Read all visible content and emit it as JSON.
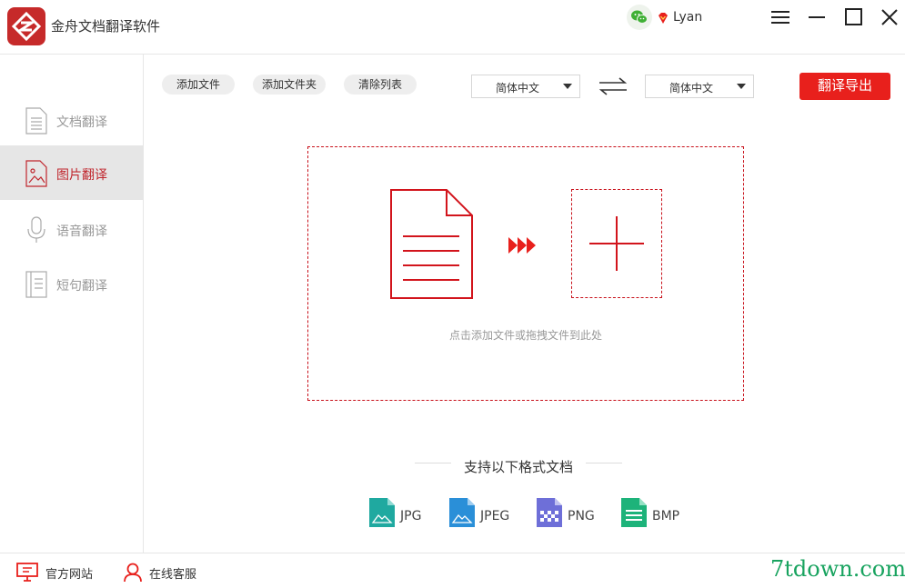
{
  "app": {
    "title": "金舟文档翻译软件"
  },
  "user": {
    "name": "Lyan"
  },
  "sidebar": {
    "items": [
      {
        "label": "文档翻译",
        "icon": "document-icon",
        "active": false
      },
      {
        "label": "图片翻译",
        "icon": "image-icon",
        "active": true
      },
      {
        "label": "语音翻译",
        "icon": "microphone-icon",
        "active": false
      },
      {
        "label": "短句翻译",
        "icon": "note-icon",
        "active": false
      }
    ]
  },
  "toolbar": {
    "add_file": "添加文件",
    "add_folder": "添加文件夹",
    "clear_list": "清除列表",
    "source_lang": "简体中文",
    "target_lang": "简体中文",
    "translate_export": "翻译导出"
  },
  "drop_zone": {
    "hint": "点击添加文件或拖拽文件到此处"
  },
  "formats": {
    "title": "支持以下格式文档",
    "items": [
      {
        "label": "JPG",
        "color": "#1fa9a0"
      },
      {
        "label": "JPEG",
        "color": "#2a8fd8"
      },
      {
        "label": "PNG",
        "color": "#6e6fd8"
      },
      {
        "label": "BMP",
        "color": "#1db37a"
      }
    ]
  },
  "footer": {
    "official_site": "官方网站",
    "online_service": "在线客服",
    "watermark": "7tdown.com"
  },
  "colors": {
    "accent": "#e8201c",
    "brand": "#c62a2a"
  }
}
